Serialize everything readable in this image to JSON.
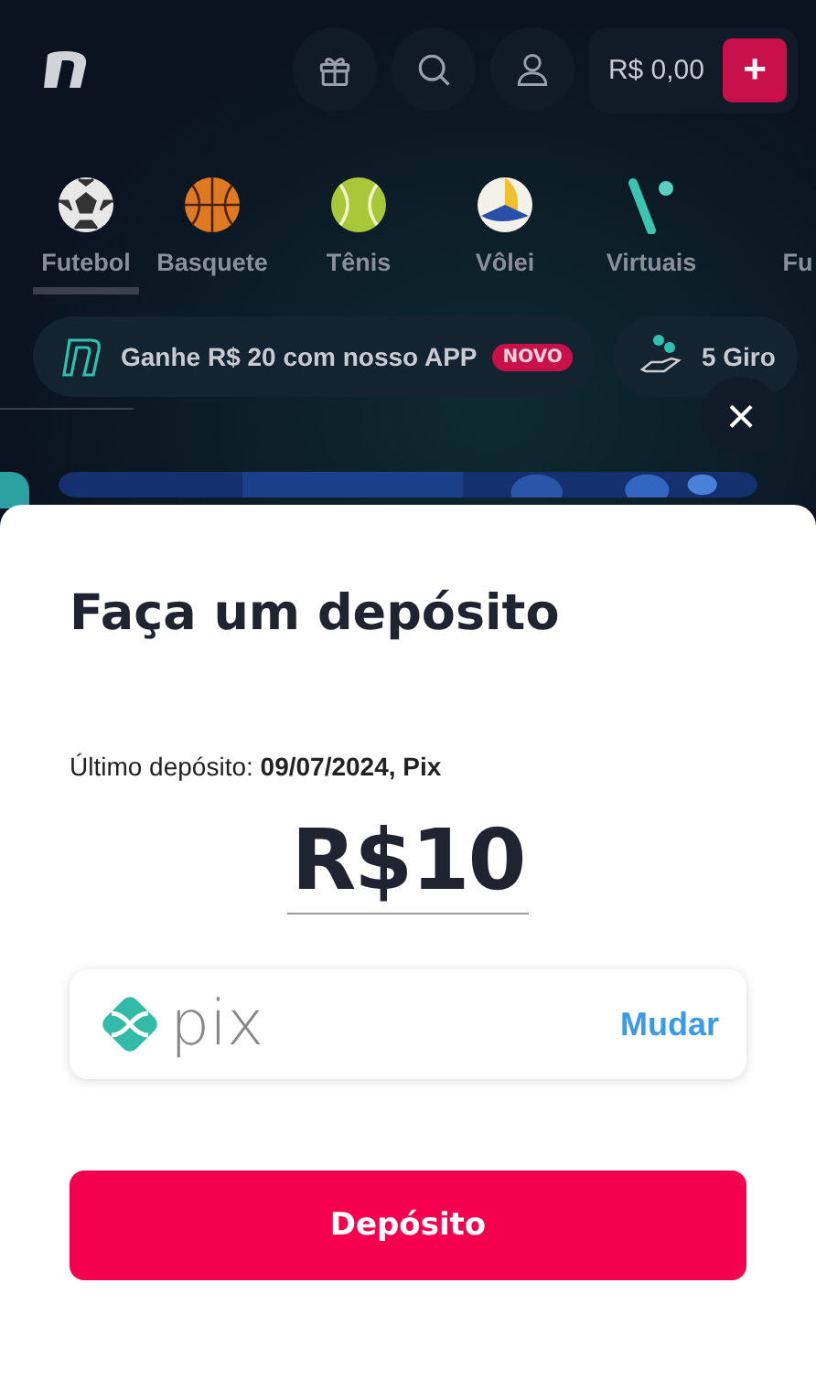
{
  "header": {
    "balance": "R$ 0,00",
    "add_button": "+"
  },
  "sports": [
    {
      "label": "Futebol",
      "selected": true
    },
    {
      "label": "Basquete",
      "selected": false
    },
    {
      "label": "Tênis",
      "selected": false
    },
    {
      "label": "Vôlei",
      "selected": false
    },
    {
      "label": "Virtuais",
      "selected": false
    },
    {
      "label": "Fu",
      "selected": false
    }
  ],
  "promos": [
    {
      "text": "Ganhe R$ 20 com nosso APP",
      "badge": "NOVO"
    },
    {
      "text": "5 Giro"
    }
  ],
  "close_button": "×",
  "sheet": {
    "title": "Faça um depósito",
    "last_deposit": "Último depósito: **09/07/2024, Pix**",
    "amount": "R$10",
    "method": {
      "logo_text": "pix",
      "action": "Mudar"
    },
    "submit": "Depósito"
  }
}
